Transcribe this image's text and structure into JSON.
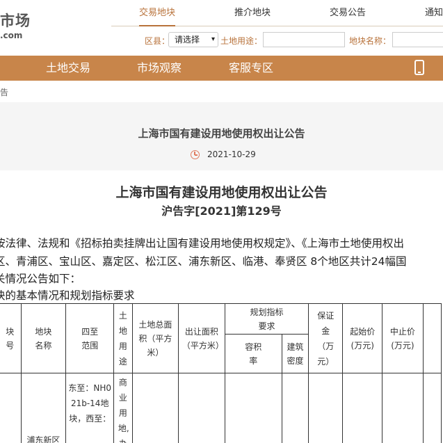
{
  "header": {
    "logo_main": "市场",
    "logo_sub": ".com",
    "tabs": [
      "交易地块",
      "推介地块",
      "交易公告",
      "通知"
    ],
    "filters": {
      "district_label": "区县：",
      "district_value": "请选择",
      "use_label": "土地用途：",
      "name_label": "地块名称："
    }
  },
  "mainnav": {
    "items": [
      "土地交易",
      "市场观察",
      "客服专区"
    ]
  },
  "breadcrumb": "告",
  "notice": {
    "band_title": "上海市国有建设用地使用权出让公告",
    "date": "2021-10-29",
    "title": "上海市国有建设用地使用权出让公告",
    "subtitle": "沪告字[2021]第129号",
    "paragraphs": [
      "按法律、法规和《招标拍卖挂牌出让国有建设用地使用权规定》、《上海市土地使用权出",
      "区、青浦区、宝山区、嘉定区、松江区、浦东新区、临港、奉贤区 8个地区共计24幅国",
      "关情况公告如下：",
      "块的基本情况和规划指标要求"
    ]
  },
  "table": {
    "headers": {
      "col1": "块号",
      "col2": "地块名称",
      "col3": "四至范围",
      "col4": "土地用途",
      "col5": "土地总面积（平方米）",
      "col6": "出让面积（平方米）",
      "col7_group": "规划指标要求",
      "col7a": "容积率",
      "col7b": "建筑密度",
      "col8": "保证金（万元）",
      "col9": "起始价(万元)",
      "col10": "中止价(万元)"
    },
    "row1": {
      "name": "浦东新区",
      "range": "东至：NH021b-14地块，西至：",
      "use": "商业用地,办"
    }
  }
}
